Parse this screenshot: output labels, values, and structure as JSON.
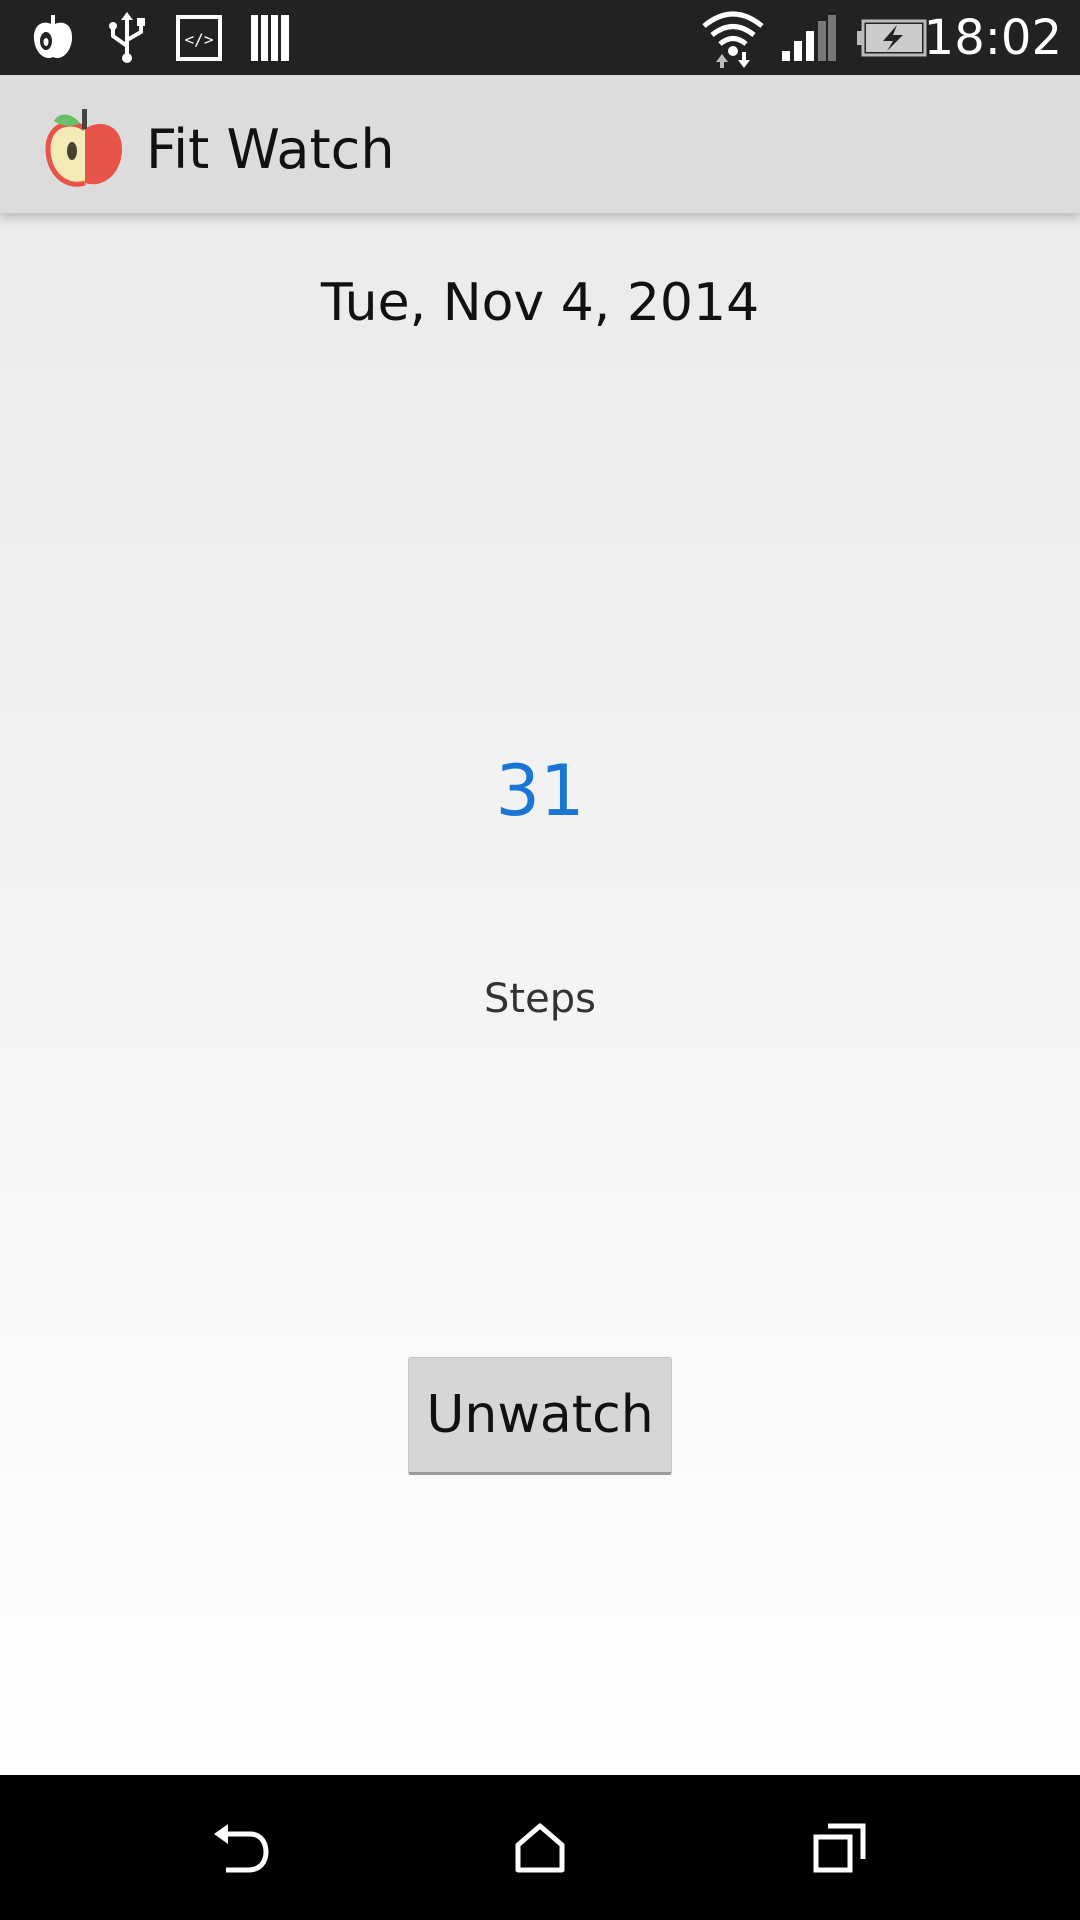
{
  "status_bar": {
    "time": "18:02",
    "notification_icons": [
      "fit-watch-notification-icon",
      "usb-icon",
      "developer-code-icon",
      "library-icon"
    ],
    "system_icons": [
      "wifi-icon",
      "cell-signal-icon",
      "battery-charging-icon"
    ]
  },
  "action_bar": {
    "title": "Fit Watch",
    "icon": "apple-icon"
  },
  "main": {
    "date": "Tue, Nov 4, 2014",
    "steps_count": "31",
    "steps_label": "Steps",
    "unwatch_label": "Unwatch"
  },
  "nav_bar": {
    "buttons": [
      "back-icon",
      "home-icon",
      "recents-icon"
    ]
  },
  "colors": {
    "accent": "#1976d2",
    "status_bar": "#222222",
    "action_bar": "#dcdcdc"
  }
}
